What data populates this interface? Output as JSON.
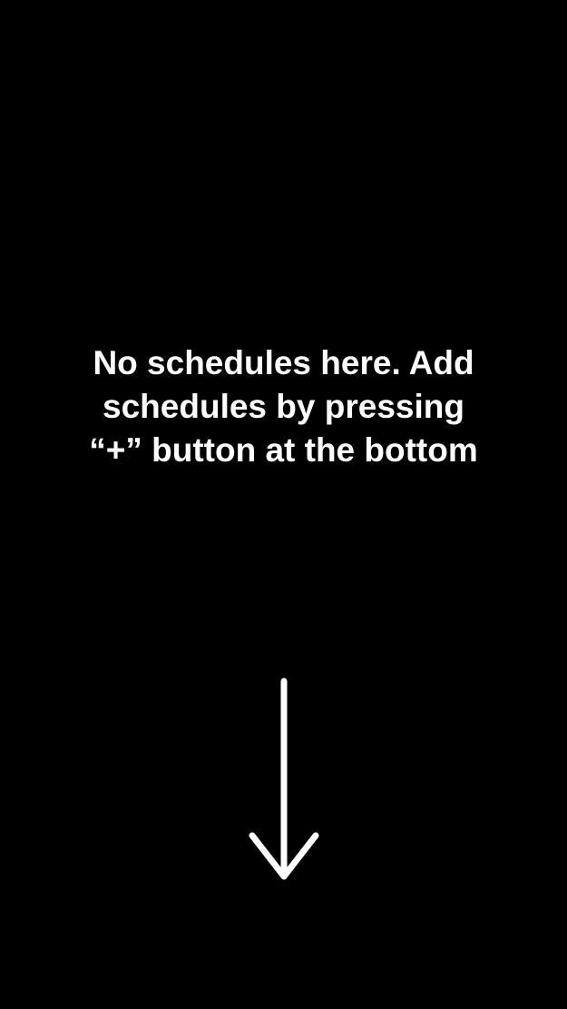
{
  "empty_state": {
    "message_lines": [
      "No schedules here. Add",
      "schedules by pressing",
      "“+” button at the bottom"
    ],
    "arrow_icon": "arrow-down-icon"
  },
  "colors": {
    "background": "#000000",
    "text": "#ffffff"
  }
}
